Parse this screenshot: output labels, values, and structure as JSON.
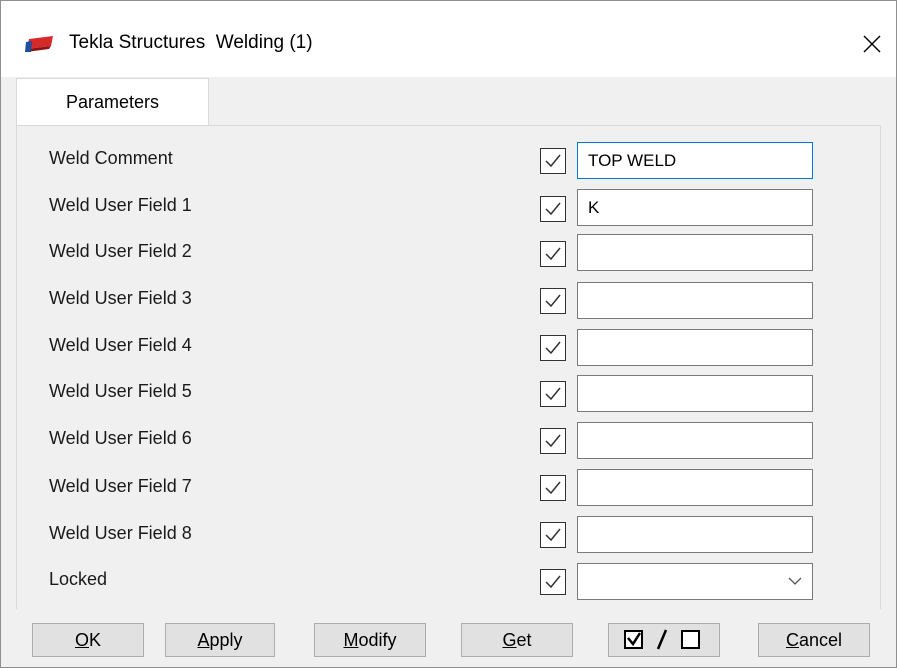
{
  "window": {
    "title": "Tekla Structures  Welding (1)"
  },
  "tabs": [
    {
      "label": "Parameters"
    }
  ],
  "fields": [
    {
      "label": "Weld Comment",
      "checked": true,
      "value": "TOP WELD"
    },
    {
      "label": "Weld User Field 1",
      "checked": true,
      "value": "K"
    },
    {
      "label": "Weld User Field 2",
      "checked": true,
      "value": ""
    },
    {
      "label": "Weld User Field 3",
      "checked": true,
      "value": ""
    },
    {
      "label": "Weld User Field 4",
      "checked": true,
      "value": ""
    },
    {
      "label": "Weld User Field 5",
      "checked": true,
      "value": ""
    },
    {
      "label": "Weld User Field 6",
      "checked": true,
      "value": ""
    },
    {
      "label": "Weld User Field 7",
      "checked": true,
      "value": ""
    },
    {
      "label": "Weld User Field 8",
      "checked": true,
      "value": ""
    },
    {
      "label": "Locked",
      "checked": true,
      "value": ""
    }
  ],
  "buttons": {
    "ok": {
      "mnemonic": "O",
      "rest": "K"
    },
    "apply": {
      "mnemonic": "A",
      "rest": "pply"
    },
    "modify": {
      "mnemonic": "M",
      "rest": "odify"
    },
    "get": {
      "mnemonic": "G",
      "rest": "et"
    },
    "cancel": {
      "mnemonic": "C",
      "rest": "ancel"
    }
  },
  "icons": {
    "app": "tekla-logo-icon",
    "close": "close-icon",
    "checkbox_check": "checkmark-icon",
    "dropdown": "chevron-down-icon",
    "toggle": "check-all-toggle-icon"
  }
}
